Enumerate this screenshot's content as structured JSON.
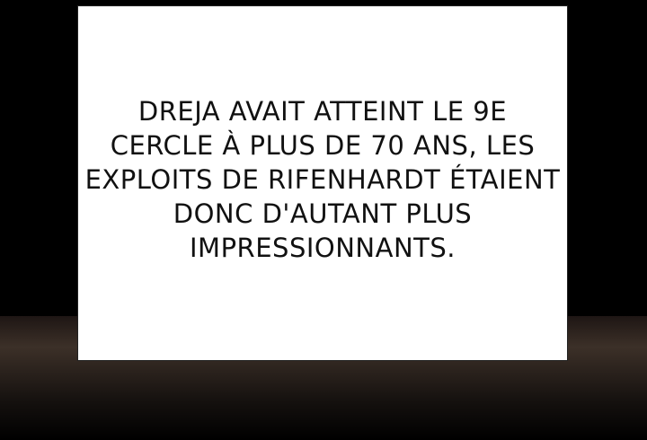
{
  "caption": {
    "lines": [
      "DREJA AVAIT ATTEINT LE 9E",
      "CERCLE À PLUS DE 70 ANS, LES",
      "EXPLOITS DE RIFENHARDT ÉTAIENT",
      "DONC D'AUTANT PLUS",
      "IMPRESSIONNANTS."
    ]
  },
  "colors": {
    "background": "#000000",
    "box": "#ffffff",
    "text": "#111111"
  }
}
